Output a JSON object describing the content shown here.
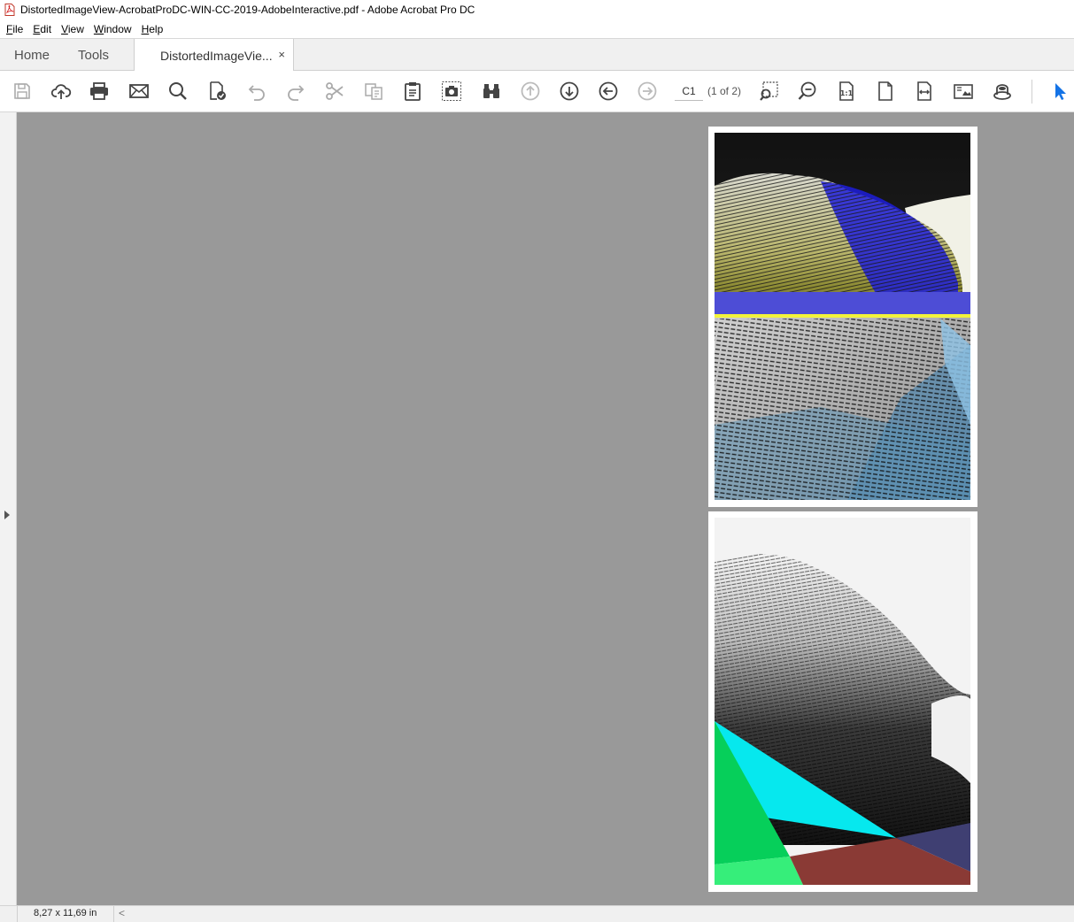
{
  "window": {
    "title": "DistortedImageView-AcrobatProDC-WIN-CC-2019-AdobeInteractive.pdf - Adobe Acrobat Pro DC"
  },
  "menu": [
    "File",
    "Edit",
    "View",
    "Window",
    "Help"
  ],
  "tabs": {
    "home": "Home",
    "tools": "Tools",
    "document": "DistortedImageVie...",
    "close_glyph": "×"
  },
  "toolbar": {
    "icons": [
      "save-icon",
      "upload-cloud-icon",
      "print-icon",
      "email-icon",
      "search-icon",
      "sign-document-icon",
      "undo-icon",
      "redo-icon",
      "cut-icon",
      "copy-icon",
      "paste-icon",
      "snapshot-icon",
      "find-binoculars-icon",
      "page-up-icon",
      "page-down-icon",
      "back-icon",
      "forward-icon",
      "marquee-zoom-icon",
      "zoom-out-icon",
      "actual-size-icon",
      "fit-page-icon",
      "fit-width-icon",
      "page-thumbnails-icon",
      "read-aloud-icon",
      "select-cursor-icon"
    ],
    "page_value": "C1",
    "page_count": "(1 of 2)"
  },
  "status": {
    "page_size": "8,27 x 11,69 in",
    "scroll_left_glyph": "<"
  },
  "colors": {
    "workspace_gray": "#999999",
    "accent_blue": "#1473e6",
    "pdf_red": "#d7191c"
  }
}
